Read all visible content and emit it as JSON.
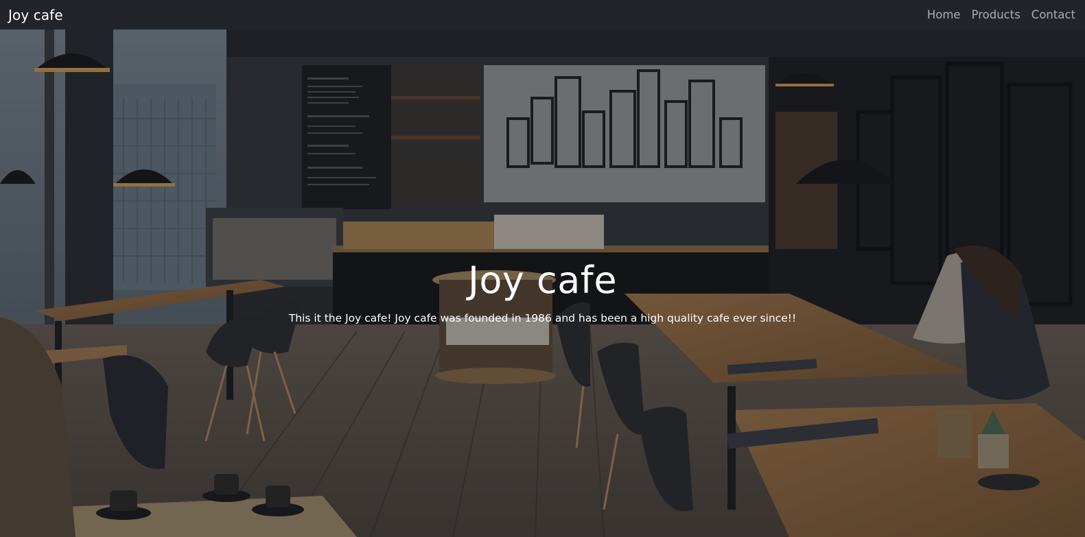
{
  "navbar": {
    "brand": "Joy cafe",
    "links": [
      {
        "label": "Home"
      },
      {
        "label": "Products"
      },
      {
        "label": "Contact"
      }
    ]
  },
  "hero": {
    "title": "Joy cafe",
    "subtitle": "This it the Joy cafe! Joy cafe was founded in 1986 and has been a high quality cafe ever since!!"
  },
  "colors": {
    "navbar_bg": "#212529",
    "brand_text": "#ffffff",
    "nav_link_text": "#adb5bd"
  }
}
